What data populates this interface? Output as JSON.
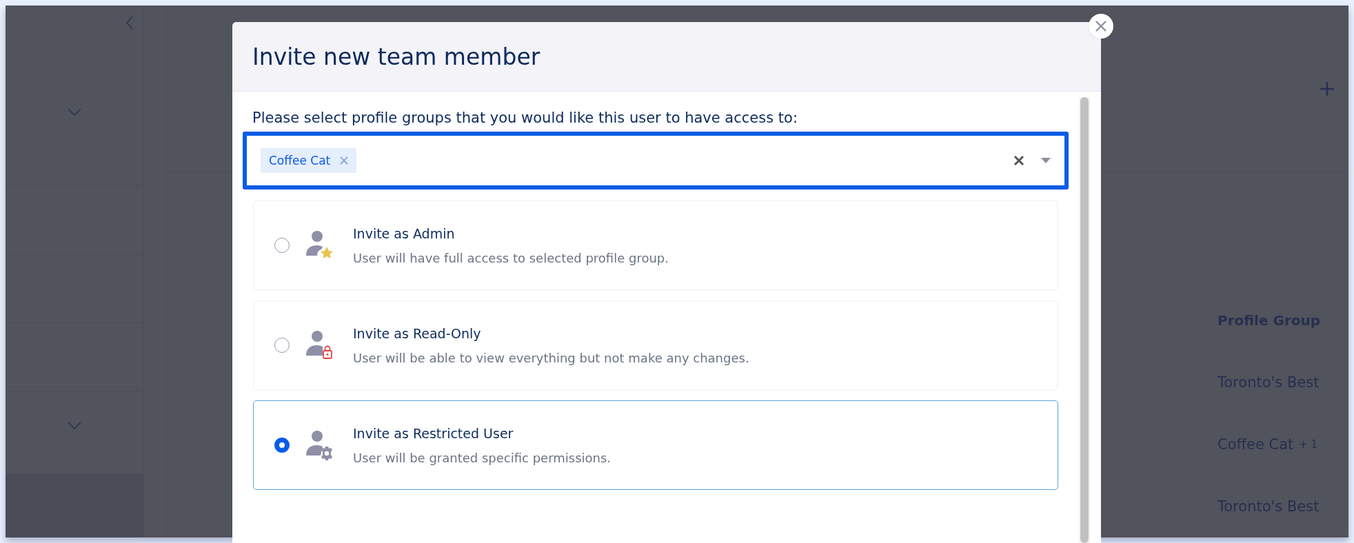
{
  "background": {
    "table": {
      "columns": [
        "Profile Group"
      ],
      "rows": [
        {
          "profile_group": "Toronto's Best"
        },
        {
          "profile_group": "Coffee Cat",
          "extra": "+ 1"
        },
        {
          "profile_group": "Toronto's Best"
        }
      ]
    }
  },
  "modal": {
    "title": "Invite new team member",
    "prompt": "Please select profile groups that you would like this user to have access to:",
    "select": {
      "chips": [
        {
          "label": "Coffee Cat"
        }
      ]
    },
    "options": [
      {
        "kind": "admin",
        "title": "Invite as Admin",
        "description": "User will have full access to selected profile group.",
        "selected": false
      },
      {
        "kind": "read_only",
        "title": "Invite as Read-Only",
        "description": "User will be able to view everything but not make any changes.",
        "selected": false
      },
      {
        "kind": "restricted",
        "title": "Invite as Restricted User",
        "description": "User will be granted specific permissions.",
        "selected": true
      }
    ]
  }
}
